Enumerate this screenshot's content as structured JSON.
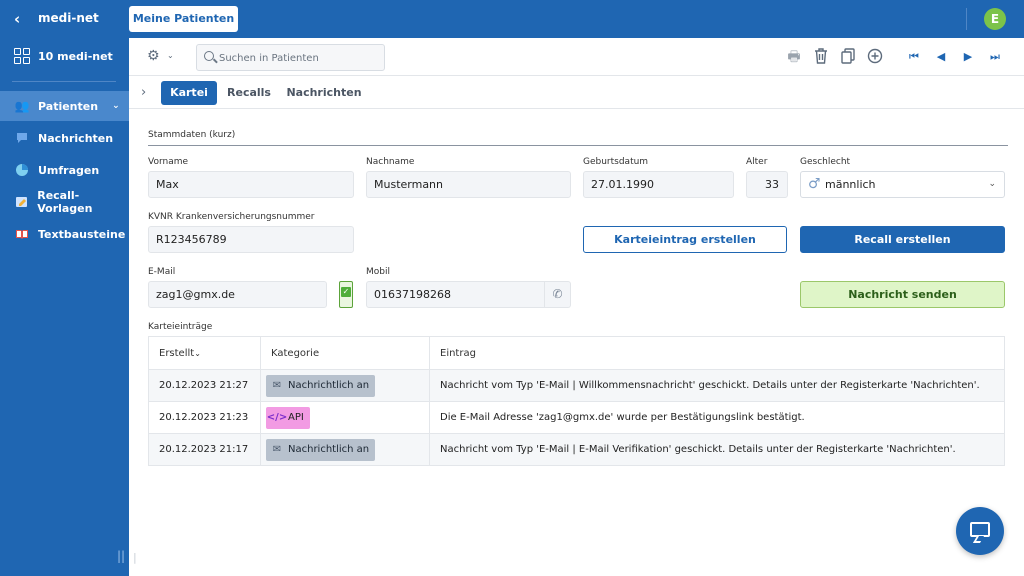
{
  "app": {
    "title": "medi-net",
    "back_icon": "chevron-left-icon",
    "avatar_initial": "E",
    "avatar_color": "#7cc34a",
    "brand_color": "#1f66b2"
  },
  "top_tab": {
    "label": "Meine Patienten"
  },
  "sidebar": {
    "home": {
      "label": "10 medi-net",
      "icon": "grid-icon"
    },
    "items": [
      {
        "label": "Patienten",
        "icon": "patients-icon",
        "active": true,
        "expandable": true
      },
      {
        "label": "Nachrichten",
        "icon": "message-icon"
      },
      {
        "label": "Umfragen",
        "icon": "pie-chart-icon"
      },
      {
        "label": "Recall-Vorlagen",
        "icon": "recall-template-icon"
      },
      {
        "label": "Textbausteine",
        "icon": "book-icon"
      }
    ],
    "handle": "||"
  },
  "toolbar": {
    "search_placeholder": "Suchen in Patienten",
    "actions": [
      "print-icon",
      "trash-icon",
      "copy-icon",
      "add-icon"
    ],
    "navigation": [
      "first-icon",
      "previous-icon",
      "next-icon",
      "last-icon"
    ]
  },
  "tabs": [
    {
      "label": "Kartei",
      "active": true
    },
    {
      "label": "Recalls",
      "active": false
    },
    {
      "label": "Nachrichten",
      "active": false
    }
  ],
  "stammdaten": {
    "section_title": "Stammdaten (kurz)",
    "vorname_label": "Vorname",
    "vorname": "Max",
    "nachname_label": "Nachname",
    "nachname": "Mustermann",
    "geburtsdatum_label": "Geburtsdatum",
    "geburtsdatum": "27.01.1990",
    "alter_label": "Alter",
    "alter": "33",
    "geschlecht_label": "Geschlecht",
    "geschlecht": "männlich",
    "kvnr_label": "KVNR Krankenversicherungsnummer",
    "kvnr": "R123456789",
    "email_label": "E-Mail",
    "email": "zag1@gmx.de",
    "email_verified": true,
    "mobil_label": "Mobil",
    "mobil": "01637198268"
  },
  "buttons": {
    "karteieintrag": "Karteieintrag erstellen",
    "recall": "Recall erstellen",
    "nachricht": "Nachricht senden"
  },
  "karteieintraege": {
    "title": "Karteieinträge",
    "columns": [
      "Erstellt",
      "Kategorie",
      "Eintrag"
    ],
    "rows": [
      {
        "erstellt": "20.12.2023 21:27",
        "kategorie": "Nachrichtlich an",
        "kategorie_icon": "mail-icon",
        "kategorie_color": "#b7c1cd",
        "eintrag": "Nachricht vom Typ 'E-Mail | Willkommensnachricht' geschickt. Details unter der Registerkarte 'Nachrichten'."
      },
      {
        "erstellt": "20.12.2023 21:23",
        "kategorie": "API",
        "kategorie_icon": "code-icon",
        "kategorie_color": "#f29be3",
        "eintrag": "Die E-Mail Adresse 'zag1@gmx.de' wurde per Bestätigungslink bestätigt."
      },
      {
        "erstellt": "20.12.2023 21:17",
        "kategorie": "Nachrichtlich an",
        "kategorie_icon": "mail-icon",
        "kategorie_color": "#b7c1cd",
        "eintrag": "Nachricht vom Typ 'E-Mail | E-Mail Verifikation' geschickt. Details unter der Registerkarte 'Nachrichten'."
      }
    ]
  },
  "chat_button_icon": "chat-icon"
}
